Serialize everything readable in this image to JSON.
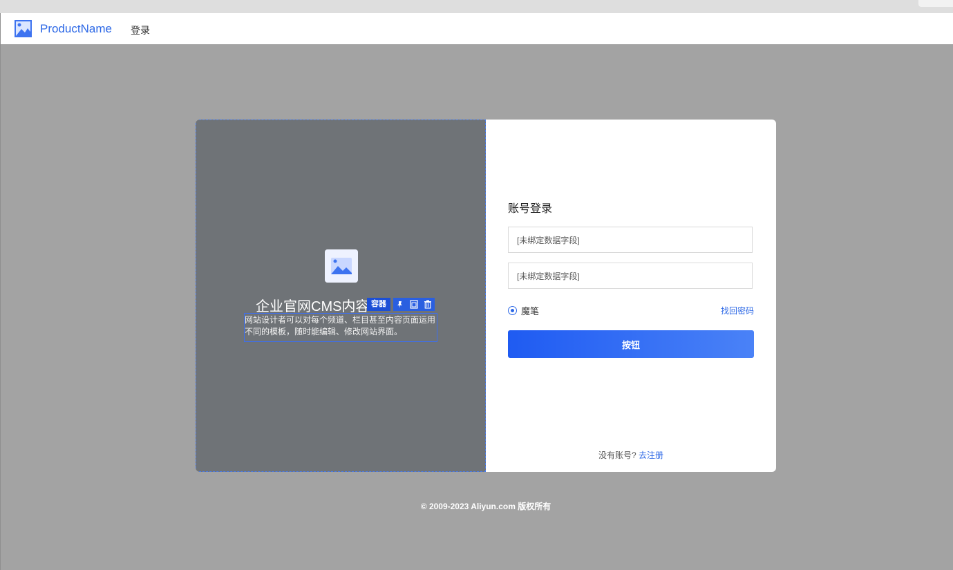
{
  "header": {
    "product_name": "ProductName",
    "nav_login": "登录"
  },
  "left_panel": {
    "title": "企业官网CMS内容",
    "toolbar_tag": "容器",
    "description": "网站设计者可以对每个频道、栏目甚至内容页面运用不同的模板，随时能编辑、修改网站界面。"
  },
  "login_form": {
    "title": "账号登录",
    "field1_value": "[未绑定数据字段]",
    "field2_value": "[未绑定数据字段]",
    "radio_label": "魔笔",
    "forgot_password": "找回密码",
    "submit_label": "按钮",
    "no_account": "没有账号?",
    "register_link": "去注册"
  },
  "footer": {
    "copyright": "© 2009-2023 Aliyun.com 版权所有"
  },
  "colors": {
    "accent": "#2b67e6",
    "left_panel_bg": "#6f7377",
    "page_bg": "#a3a3a3"
  }
}
